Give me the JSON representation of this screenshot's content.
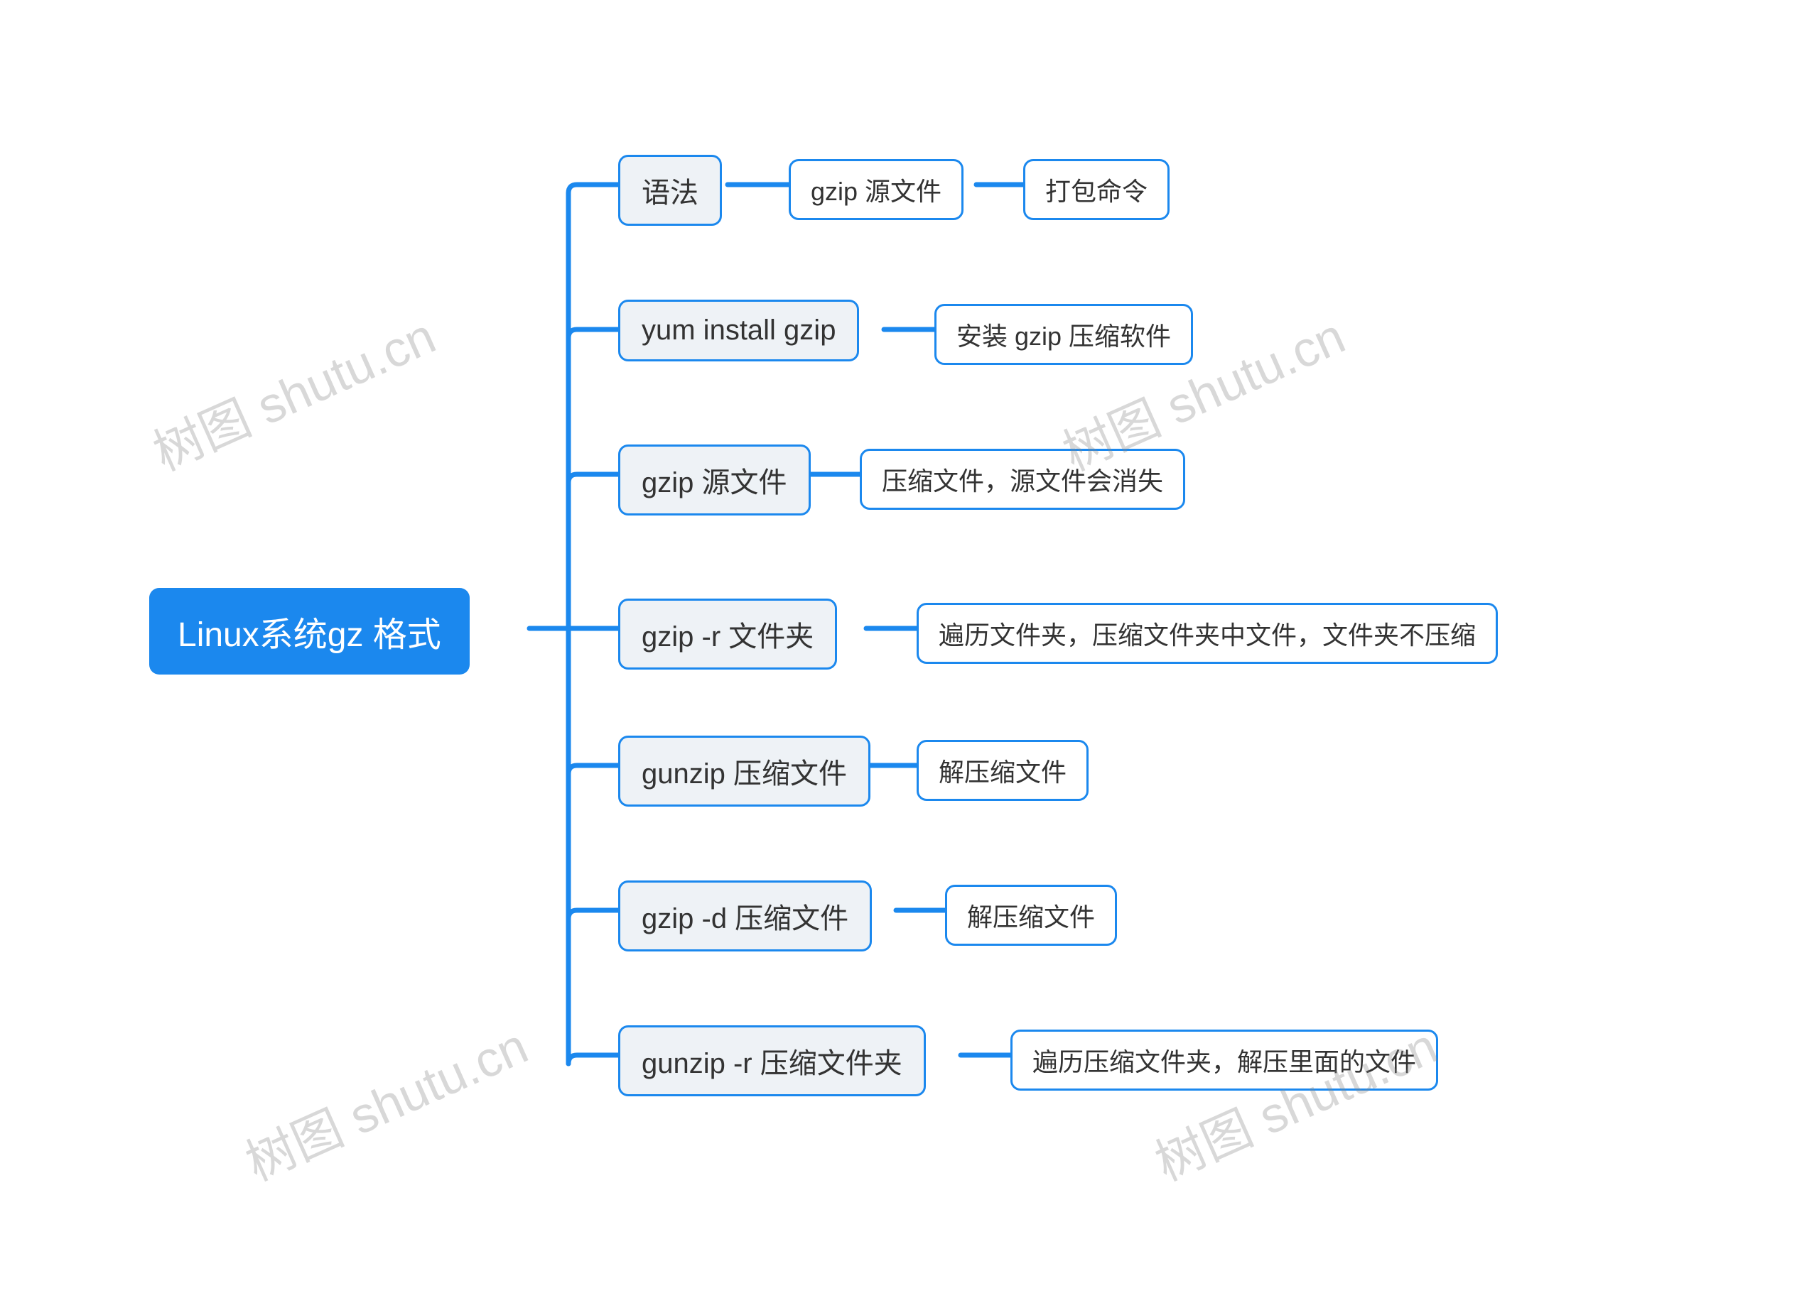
{
  "watermark_text": "树图 shutu.cn",
  "root": {
    "label": "Linux系统gz 格式"
  },
  "branches": [
    {
      "label": "语法",
      "children": [
        {
          "label": "gzip 源文件",
          "children": [
            {
              "label": "打包命令"
            }
          ]
        }
      ]
    },
    {
      "label": "yum install gzip",
      "children": [
        {
          "label": "安装 gzip 压缩软件"
        }
      ]
    },
    {
      "label": "gzip 源文件",
      "children": [
        {
          "label": "压缩文件，源文件会消失"
        }
      ]
    },
    {
      "label": "gzip -r 文件夹",
      "children": [
        {
          "label": "遍历文件夹，压缩文件夹中文件，文件夹不压缩"
        }
      ]
    },
    {
      "label": "gunzip 压缩文件",
      "children": [
        {
          "label": "解压缩文件"
        }
      ]
    },
    {
      "label": "gzip -d 压缩文件",
      "children": [
        {
          "label": "解压缩文件"
        }
      ]
    },
    {
      "label": "gunzip -r 压缩文件夹",
      "children": [
        {
          "label": "遍历压缩文件夹，解压里面的文件"
        }
      ]
    }
  ],
  "colors": {
    "accent": "#1b88ee",
    "branch_fill": "#eef2f6",
    "leaf_fill": "#ffffff"
  }
}
